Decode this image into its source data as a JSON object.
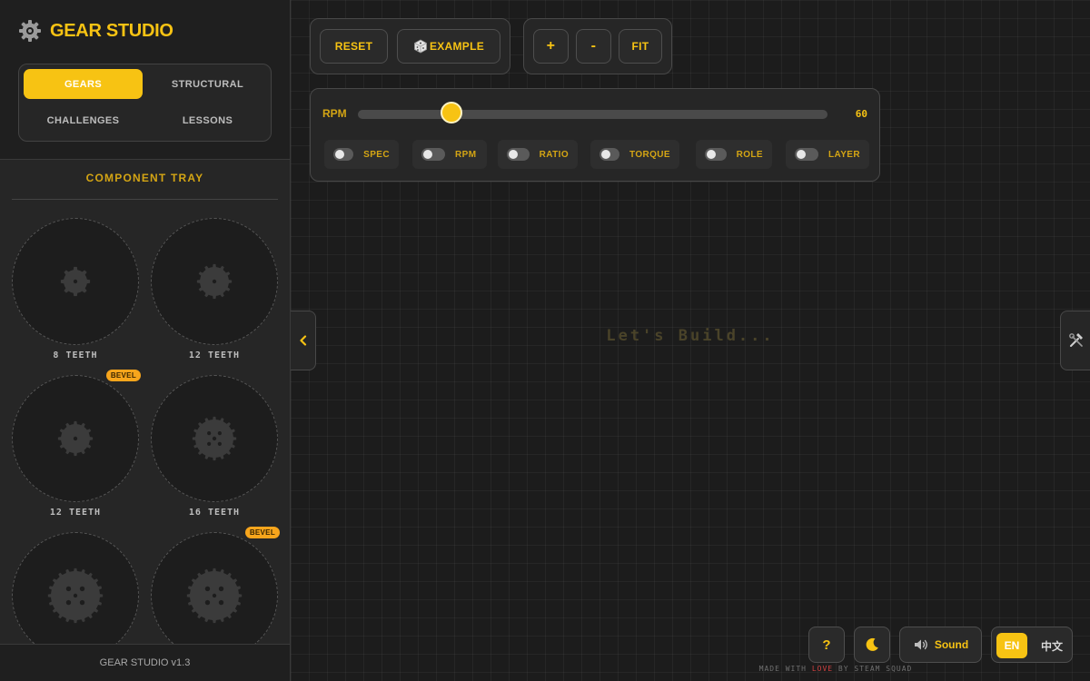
{
  "colors": {
    "accent": "#f7c313",
    "bevel_badge": "#f7a51c",
    "love": "#d04040"
  },
  "brand": {
    "title": "GEAR STUDIO",
    "icon": "gear-icon"
  },
  "mode_tabs": [
    {
      "label": "GEARS",
      "active": true
    },
    {
      "label": "STRUCTURAL",
      "active": false
    },
    {
      "label": "CHALLENGES",
      "active": false
    },
    {
      "label": "LESSONS",
      "active": false
    }
  ],
  "tray": {
    "title": "COMPONENT TRAY",
    "items": [
      {
        "label": "8 TEETH",
        "teeth": 8,
        "bevel": false
      },
      {
        "label": "12 TEETH",
        "teeth": 12,
        "bevel": false
      },
      {
        "label": "12 TEETH",
        "teeth": 12,
        "bevel": true,
        "badge": "BEVEL"
      },
      {
        "label": "16 TEETH",
        "teeth": 16,
        "bevel": false
      },
      {
        "label": "",
        "teeth": 20,
        "bevel": false
      },
      {
        "label": "",
        "teeth": 20,
        "bevel": true,
        "badge": "BEVEL"
      }
    ]
  },
  "sidebar_footer": "GEAR STUDIO v1.3",
  "toolbar": {
    "reset_label": "RESET",
    "example_label": "EXAMPLE",
    "example_icon": "dice-icon",
    "zoom_in_label": "+",
    "zoom_out_label": "-",
    "fit_label": "FIT"
  },
  "rpm": {
    "label": "RPM",
    "value": "60",
    "fraction": 0.2
  },
  "toggles": [
    {
      "label": "SPEC",
      "on": false
    },
    {
      "label": "RPM",
      "on": false
    },
    {
      "label": "RATIO",
      "on": false
    },
    {
      "label": "TORQUE",
      "on": false
    },
    {
      "label": "ROLE",
      "on": false
    },
    {
      "label": "LAYER",
      "on": false
    }
  ],
  "canvas": {
    "placeholder": "Let's Build..."
  },
  "side_tabs": {
    "collapse_icon": "chevron-left-icon",
    "tools_icon": "tools-icon"
  },
  "bottom_bar": {
    "help_label": "?",
    "theme_icon": "moon-icon",
    "sound_label": "Sound",
    "sound_icon": "speaker-icon",
    "lang_en": "EN",
    "lang_zh": "中文"
  },
  "credits": {
    "prefix": "MADE WITH",
    "love": "LOVE",
    "suffix": "BY STEAM SQUAD"
  }
}
